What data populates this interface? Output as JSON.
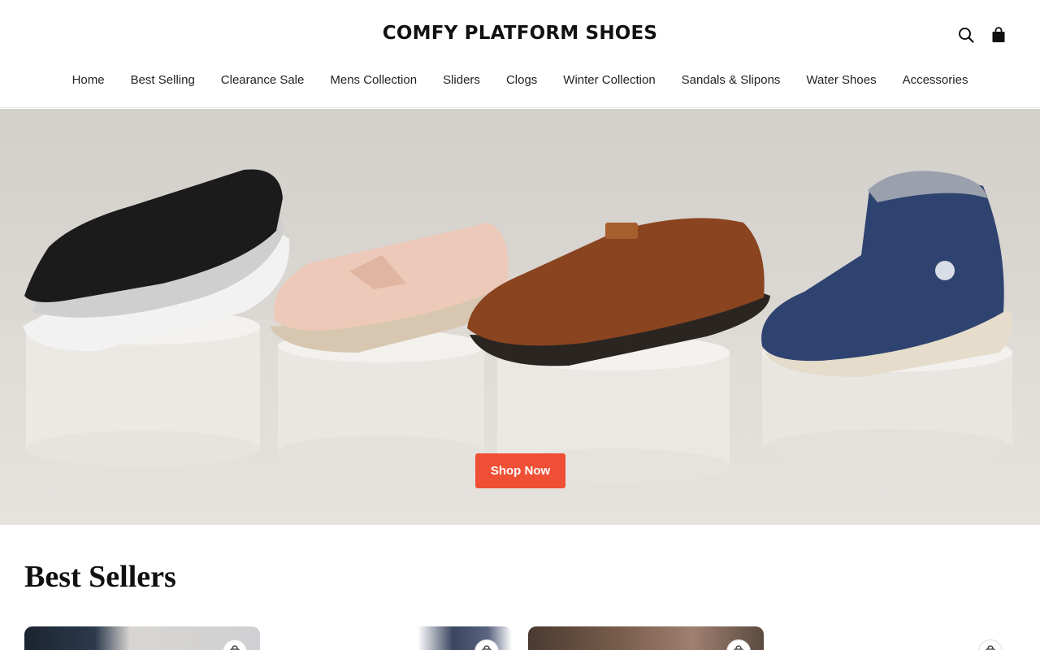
{
  "brand": {
    "logo_text": "COMFY PLATFORM SHOES"
  },
  "header": {
    "icons": [
      "search-icon",
      "shopping-bag-icon"
    ]
  },
  "nav": {
    "items": [
      {
        "label": "Home"
      },
      {
        "label": "Best Selling"
      },
      {
        "label": "Clearance Sale"
      },
      {
        "label": "Mens Collection"
      },
      {
        "label": "Sliders"
      },
      {
        "label": "Clogs"
      },
      {
        "label": "Winter Collection"
      },
      {
        "label": "Sandals & Slipons"
      },
      {
        "label": "Water Shoes"
      },
      {
        "label": "Accessories"
      }
    ]
  },
  "hero": {
    "cta_label": "Shop Now",
    "cta_color": "#ef4f34"
  },
  "best_sellers": {
    "title": "Best Sellers",
    "products": [
      {
        "icon": "cart-icon"
      },
      {
        "icon": "cart-icon"
      },
      {
        "icon": "cart-icon"
      },
      {
        "icon": "cart-icon"
      }
    ]
  }
}
